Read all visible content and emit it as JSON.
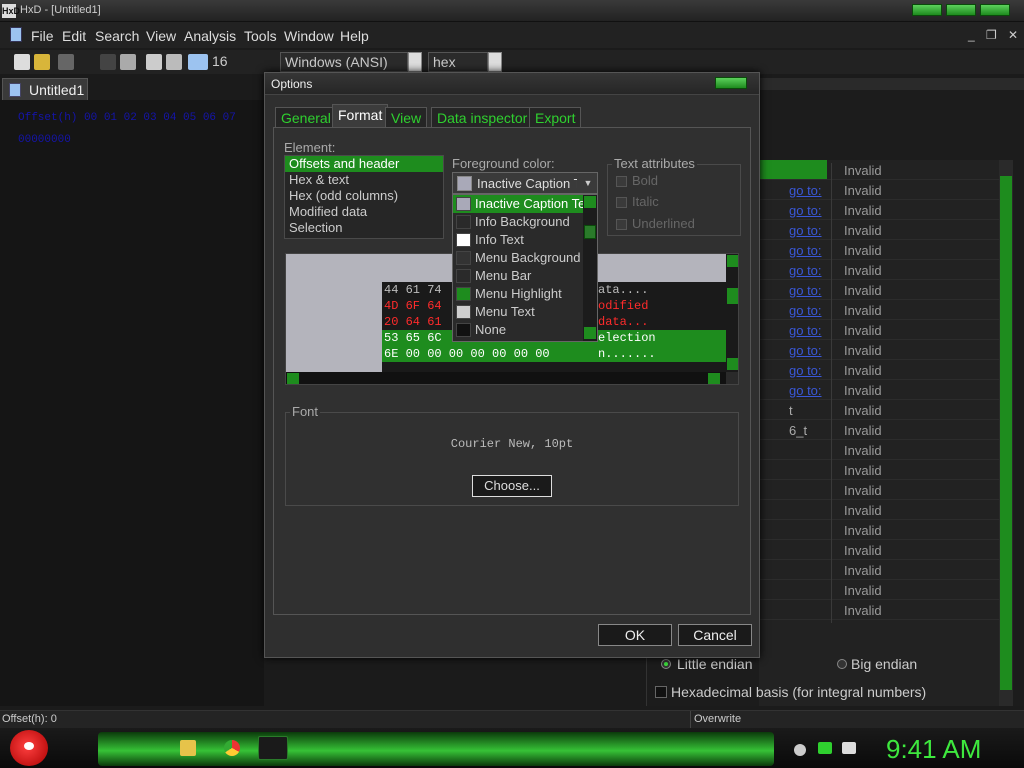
{
  "window": {
    "title": "HxD - [Untitled1]",
    "app_icon": "HxD"
  },
  "menu": {
    "items": [
      "File",
      "Edit",
      "Search",
      "View",
      "Analysis",
      "Tools",
      "Window",
      "Help"
    ]
  },
  "mdi_controls": {
    "minimize": "_",
    "restore": "❐",
    "close": "✕"
  },
  "toolbar": {
    "bytes_per_row": "16",
    "charset": "Windows (ANSI)",
    "display_mode": "hex"
  },
  "document": {
    "tab_label": "Untitled1",
    "offset_header": "Offset(h)  00 01 02 03 04 05 06 07",
    "offset_row": "00000000"
  },
  "inspector": {
    "rows": [
      {
        "link": "",
        "value": "Invalid"
      },
      {
        "link": "go to:",
        "value": "Invalid"
      },
      {
        "link": "go to:",
        "value": "Invalid"
      },
      {
        "link": "go to:",
        "value": "Invalid"
      },
      {
        "link": "go to:",
        "value": "Invalid"
      },
      {
        "link": "go to:",
        "value": "Invalid"
      },
      {
        "link": "go to:",
        "value": "Invalid"
      },
      {
        "link": "go to:",
        "value": "Invalid"
      },
      {
        "link": "go to:",
        "value": "Invalid"
      },
      {
        "link": "go to:",
        "value": "Invalid"
      },
      {
        "link": "go to:",
        "value": "Invalid"
      },
      {
        "link": "go to:",
        "value": "Invalid"
      },
      {
        "label": "t",
        "value": "Invalid"
      },
      {
        "label": "6_t",
        "value": "Invalid"
      },
      {
        "label": "",
        "value": "Invalid"
      },
      {
        "label": "",
        "value": "Invalid"
      },
      {
        "label": "",
        "value": "Invalid"
      },
      {
        "label": "",
        "value": "Invalid"
      },
      {
        "label": "",
        "value": "Invalid"
      },
      {
        "label": "",
        "value": "Invalid"
      },
      {
        "label": "",
        "value": "Invalid"
      },
      {
        "label": "",
        "value": "Invalid"
      },
      {
        "label": "",
        "value": "Invalid"
      }
    ],
    "little_endian": "Little endian",
    "big_endian": "Big endian",
    "hex_basis": "Hexadecimal basis (for integral numbers)"
  },
  "status": {
    "offset": "Offset(h): 0",
    "mode": "Overwrite"
  },
  "taskbar": {
    "clock": "9:41 AM"
  },
  "dialog": {
    "title": "Options",
    "tabs": [
      "General",
      "Format",
      "View",
      "Data inspector",
      "Export"
    ],
    "active_tab": "Format",
    "element_label": "Element:",
    "elements": [
      "Offsets and header",
      "Hex & text",
      "Hex (odd columns)",
      "Modified data",
      "Selection"
    ],
    "selected_element": "Offsets and header",
    "fg_label": "Foreground color:",
    "fg_value": "Inactive Caption Text",
    "color_options": [
      {
        "label": "Inactive Caption Text",
        "color": "#a9a9b8",
        "selected": true
      },
      {
        "label": "Info Background",
        "color": "#2a2a2a"
      },
      {
        "label": "Info Text",
        "color": "#ffffff"
      },
      {
        "label": "Menu Background",
        "color": "#333333"
      },
      {
        "label": "Menu Bar",
        "color": "#2a2a2a"
      },
      {
        "label": "Menu Highlight",
        "color": "#1e8c1e"
      },
      {
        "label": "Menu Text",
        "color": "#cfcfcf"
      },
      {
        "label": "None",
        "color": "#111111"
      }
    ],
    "text_attributes": {
      "legend": "Text attributes",
      "bold": "Bold",
      "italic": "Italic",
      "underlined": "Underlined"
    },
    "preview_lines": [
      {
        "hex": "44 61 74",
        "text": "ata....",
        "color": "#bdbdbd"
      },
      {
        "hex": "4D 6F 64",
        "text": "odified",
        "color": "#ff2b2b"
      },
      {
        "hex": "20 64 61",
        "text": "data...",
        "color": "#ff2b2b"
      },
      {
        "hex": "53 65 6C",
        "text": "election",
        "color": "#ffffff",
        "selected": true
      },
      {
        "hex": "6E 00 00 00 00 00 00 00",
        "text": "n.......",
        "color": "#ffffff",
        "selected": true
      }
    ],
    "font_legend": "Font",
    "font_name": "Courier New, 10pt",
    "choose_button": "Choose...",
    "ok_button": "OK",
    "cancel_button": "Cancel"
  },
  "colors": {
    "accent": "#1e8c1e",
    "accent_bright": "#3ee83e",
    "link": "#3a58d8"
  }
}
